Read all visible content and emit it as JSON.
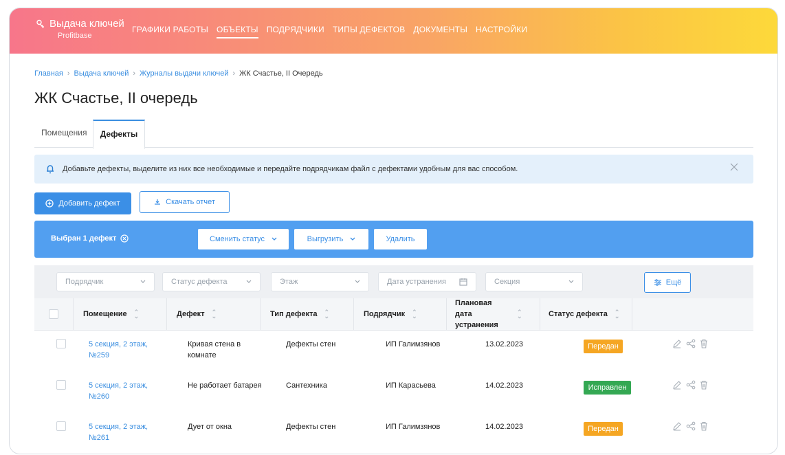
{
  "app": {
    "title": "Выдача ключей",
    "subtitle": "Profitbase"
  },
  "nav": {
    "items": [
      {
        "label": "ГРАФИКИ РАБОТЫ",
        "active": false
      },
      {
        "label": "ОБЪЕКТЫ",
        "active": true
      },
      {
        "label": "ПОДРЯДЧИКИ",
        "active": false
      },
      {
        "label": "ТИПЫ ДЕФЕКТОВ",
        "active": false
      },
      {
        "label": "ДОКУМЕНТЫ",
        "active": false
      },
      {
        "label": "НАСТРОЙКИ",
        "active": false
      }
    ]
  },
  "breadcrumb": [
    "Главная",
    "Выдача ключей",
    "Журналы выдачи ключей",
    "ЖК Счастье, II Очередь"
  ],
  "page_title": "ЖК Счастье, II очередь",
  "tabs": [
    {
      "label": "Помещения",
      "active": false
    },
    {
      "label": "Дефекты",
      "active": true
    }
  ],
  "alert": {
    "text": "Добавьте дефекты, выделите из них все необходимые и передайте подрядчикам файл с дефектами удобным для вас способом."
  },
  "actions": {
    "add_label": "Добавить дефект",
    "download_label": "Скачать отчет"
  },
  "selection": {
    "label": "Выбран 1 дефект",
    "change_status_label": "Сменить статус",
    "export_label": "Выгрузить",
    "delete_label": "Удалить"
  },
  "filters": {
    "contractor_placeholder": "Подрядчик",
    "status_placeholder": "Статус дефекта",
    "floor_placeholder": "Этаж",
    "date_placeholder": "Дата устранения",
    "section_placeholder": "Секция",
    "more_label": "Ещё"
  },
  "table": {
    "headers": [
      "Помещение",
      "Дефект",
      "Тип дефекта",
      "Подрядчик",
      "Плановая дата устранения",
      "Статус дефекта"
    ],
    "rows": [
      {
        "room": "5 секция, 2 этаж, №259",
        "defect": "Кривая стена в комнате",
        "type": "Дефекты стен",
        "contractor": "ИП Галимзянов",
        "date": "13.02.2023",
        "status": "Передан",
        "status_color": "#f5a623"
      },
      {
        "room": "5 секция, 2 этаж, №260",
        "defect": "Не работает батарея",
        "type": "Сантехника",
        "contractor": "ИП Карасьева",
        "date": "14.02.2023",
        "status": "Исправлен",
        "status_color": "#34a853"
      },
      {
        "room": "5 секция, 2 этаж, №261",
        "defect": "Дует от окна",
        "type": "Дефекты стен",
        "contractor": "ИП Галимзянов",
        "date": "14.02.2023",
        "status": "Передан",
        "status_color": "#f5a623"
      }
    ]
  },
  "colors": {
    "accent": "#3b8fe6",
    "warning": "#f5a623",
    "success": "#34a853"
  }
}
